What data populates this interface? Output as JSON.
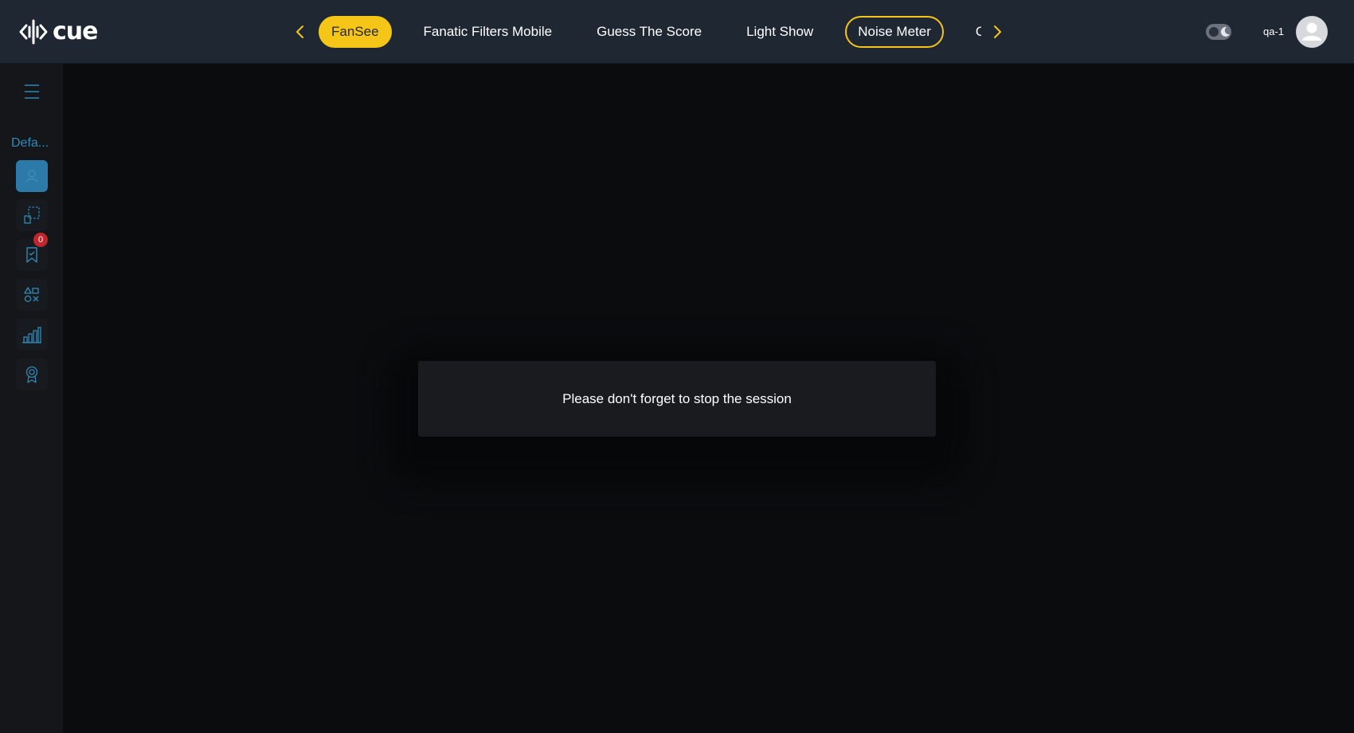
{
  "header": {
    "logo_text": "cue",
    "tabs": [
      {
        "label": "FanSee",
        "style": "filled"
      },
      {
        "label": "Fanatic Filters Mobile",
        "style": "plain"
      },
      {
        "label": "Guess The Score",
        "style": "plain"
      },
      {
        "label": "Light Show",
        "style": "plain"
      },
      {
        "label": "Noise Meter",
        "style": "outlined"
      },
      {
        "label": "Or",
        "style": "plain"
      }
    ],
    "username": "qa-1"
  },
  "sidebar": {
    "workspace_label": "Defa...",
    "items": [
      {
        "icon": "user-icon",
        "active": true
      },
      {
        "icon": "select-area-icon",
        "active": false
      },
      {
        "icon": "bookmark-icon",
        "active": false,
        "badge": "0"
      },
      {
        "icon": "shapes-icon",
        "active": false
      },
      {
        "icon": "bar-chart-icon",
        "active": false
      },
      {
        "icon": "award-icon",
        "active": false
      }
    ]
  },
  "dialog": {
    "message": "Please don't forget to stop the session"
  },
  "colors": {
    "accent": "#f5c518",
    "header_bg": "#1f2733",
    "sidebar_accent": "#2f8ab8",
    "badge": "#c0262d"
  }
}
